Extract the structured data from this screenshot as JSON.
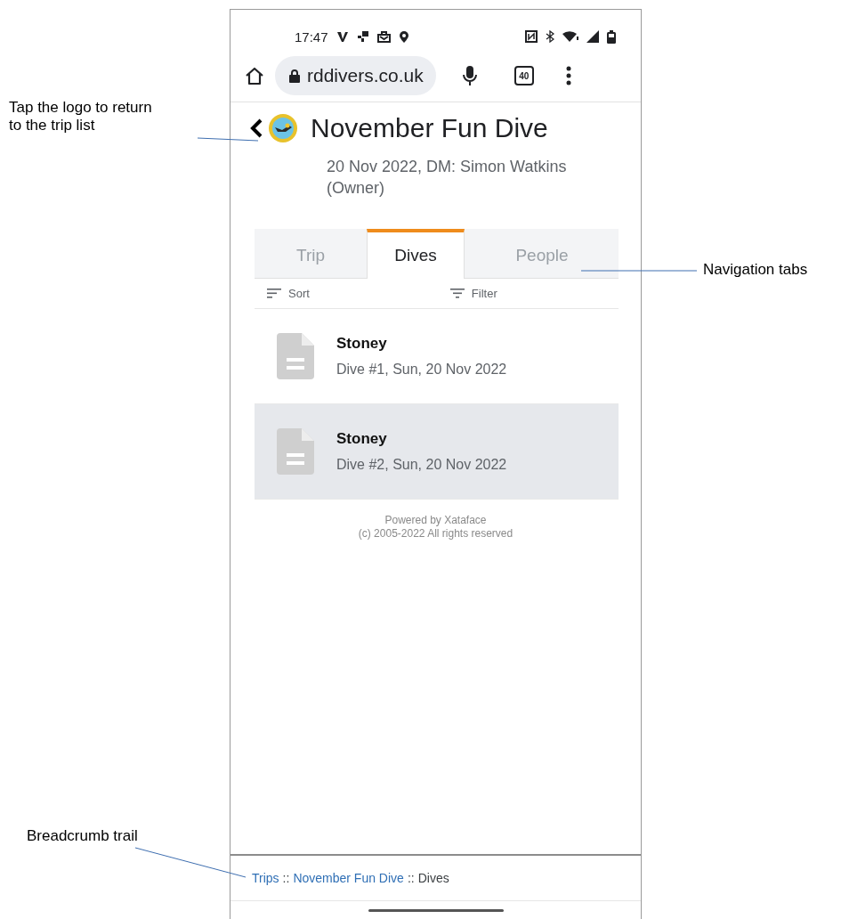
{
  "annotations": [
    {
      "kind": "logo",
      "text": "Tap the logo to return to the trip list"
    },
    {
      "kind": "tabs",
      "text": "Navigation tabs"
    },
    {
      "kind": "breadcrumb",
      "text": "Breadcrumb trail"
    }
  ],
  "status_bar": {
    "time": "17:47"
  },
  "browser": {
    "url": "rddivers.co.uk",
    "tab_count": "40"
  },
  "header": {
    "title": "November Fun Dive",
    "subtitle": "20 Nov 2022, DM: Simon Watkins (Owner)"
  },
  "tabs": [
    {
      "label": "Trip",
      "selected": false
    },
    {
      "label": "Dives",
      "selected": true
    },
    {
      "label": "People",
      "selected": false
    }
  ],
  "toolbar": {
    "sort": "Sort",
    "filter": "Filter"
  },
  "rows": [
    {
      "title": "Stoney",
      "subtitle": "Dive #1, Sun, 20 Nov 2022",
      "selected": false
    },
    {
      "title": "Stoney",
      "subtitle": "Dive #2, Sun, 20 Nov 2022",
      "selected": true
    }
  ],
  "footer": [
    "Powered by Xataface",
    "(c) 2005-2022 All rights reserved"
  ],
  "breadcrumb": [
    {
      "kind": "link",
      "text": "Trips"
    },
    {
      "kind": "separator",
      "text": "::"
    },
    {
      "kind": "link",
      "text": "November Fun Dive"
    },
    {
      "kind": "separator",
      "text": "::"
    },
    {
      "kind": "current",
      "text": "Dives"
    }
  ]
}
